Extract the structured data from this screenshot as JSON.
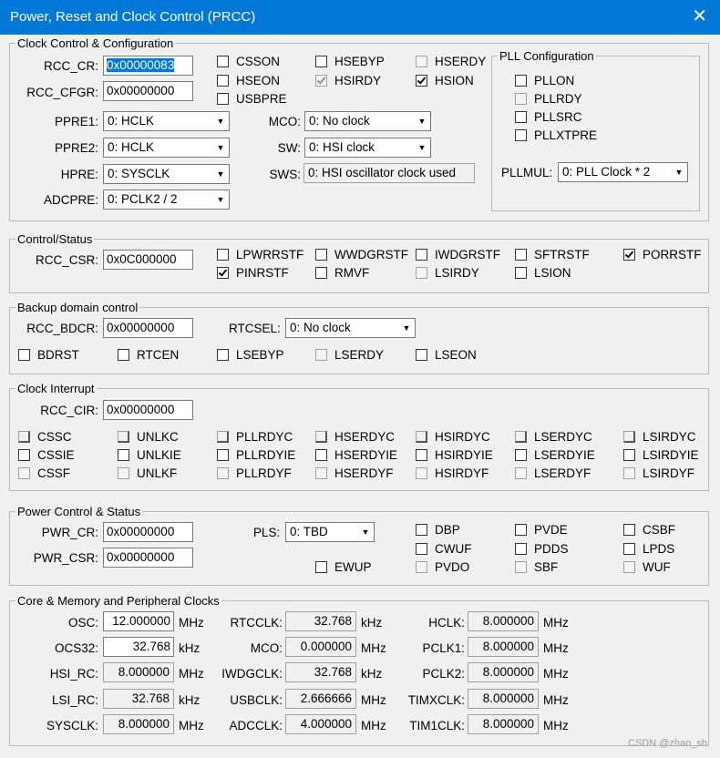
{
  "window": {
    "title": "Power, Reset and Clock Control (PRCC)",
    "close_glyph": "✕"
  },
  "clock_control": {
    "legend": "Clock Control & Configuration",
    "rcc_cr_label": "RCC_CR:",
    "rcc_cr_value": "0x00000083",
    "rcc_cfgr_label": "RCC_CFGR:",
    "rcc_cfgr_value": "0x00000000",
    "ppre1_label": "PPRE1:",
    "ppre1_value": "0: HCLK",
    "ppre2_label": "PPRE2:",
    "ppre2_value": "0: HCLK",
    "hpre_label": "HPRE:",
    "hpre_value": "0: SYSCLK",
    "adcpre_label": "ADCPRE:",
    "adcpre_value": "0: PCLK2 / 2",
    "mco_label": "MCO:",
    "mco_value": "0: No clock",
    "sw_label": "SW:",
    "sw_value": "0: HSI clock",
    "sws_label": "SWS:",
    "sws_value": "0: HSI oscillator clock used",
    "checks": {
      "csson": "CSSON",
      "hseon": "HSEON",
      "usbpre": "USBPRE",
      "hsebyp": "HSEBYP",
      "hsirdy": "HSIRDY",
      "hserdy": "HSERDY",
      "hsion": "HSION"
    }
  },
  "pll": {
    "legend": "PLL Configuration",
    "pllon": "PLLON",
    "pllrdy": "PLLRDY",
    "pllsrc": "PLLSRC",
    "pllxtpre": "PLLXTPRE",
    "pllmul_label": "PLLMUL:",
    "pllmul_value": "0: PLL Clock * 2"
  },
  "control_status": {
    "legend": "Control/Status",
    "rcc_csr_label": "RCC_CSR:",
    "rcc_csr_value": "0x0C000000",
    "lpwrrstf": "LPWRRSTF",
    "wwdgrstf": "WWDGRSTF",
    "iwdgrstf": "IWDGRSTF",
    "sftrstf": "SFTRSTF",
    "porrstf": "PORRSTF",
    "pinrstf": "PINRSTF",
    "rmvf": "RMVF",
    "lsirdy": "LSIRDY",
    "lsion": "LSION"
  },
  "backup": {
    "legend": "Backup domain control",
    "rcc_bdcr_label": "RCC_BDCR:",
    "rcc_bdcr_value": "0x00000000",
    "rtcsel_label": "RTCSEL:",
    "rtcsel_value": "0: No clock",
    "bdrst": "BDRST",
    "rtcen": "RTCEN",
    "lsebyp": "LSEBYP",
    "lserdy": "LSERDY",
    "lseon": "LSEON"
  },
  "clock_interrupt": {
    "legend": "Clock Interrupt",
    "rcc_cir_label": "RCC_CIR:",
    "rcc_cir_value": "0x00000000",
    "row1": [
      "CSSC",
      "UNLKC",
      "PLLRDYC",
      "HSERDYC",
      "HSIRDYC",
      "LSERDYC",
      "LSIRDYC"
    ],
    "row2": [
      "CSSIE",
      "UNLKIE",
      "PLLRDYIE",
      "HSERDYIE",
      "HSIRDYIE",
      "LSERDYIE",
      "LSIRDYIE"
    ],
    "row3": [
      "CSSF",
      "UNLKF",
      "PLLRDYF",
      "HSERDYF",
      "HSIRDYF",
      "LSERDYF",
      "LSIRDYF"
    ]
  },
  "power": {
    "legend": "Power Control & Status",
    "pwr_cr_label": "PWR_CR:",
    "pwr_cr_value": "0x00000000",
    "pwr_csr_label": "PWR_CSR:",
    "pwr_csr_value": "0x00000000",
    "pls_label": "PLS:",
    "pls_value": "0: TBD",
    "ewup": "EWUP",
    "dbp": "DBP",
    "cwuf": "CWUF",
    "pvdo": "PVDO",
    "pvde": "PVDE",
    "pdds": "PDDS",
    "sbf": "SBF",
    "csbf": "CSBF",
    "lpds": "LPDS",
    "wuf": "WUF"
  },
  "clocks": {
    "legend": "Core & Memory and Peripheral Clocks",
    "osc_label": "OSC:",
    "osc_value": "12.000000",
    "osc_unit": "MHz",
    "ocs32_label": "OCS32:",
    "ocs32_value": "32.768",
    "ocs32_unit": "kHz",
    "hsi_rc_label": "HSI_RC:",
    "hsi_rc_value": "8.000000",
    "hsi_rc_unit": "MHz",
    "lsi_rc_label": "LSI_RC:",
    "lsi_rc_value": "32.768",
    "lsi_rc_unit": "kHz",
    "sysclk_label": "SYSCLK:",
    "sysclk_value": "8.000000",
    "sysclk_unit": "MHz",
    "rtcclk_label": "RTCCLK:",
    "rtcclk_value": "32.768",
    "rtcclk_unit": "kHz",
    "mco_label": "MCO:",
    "mco_value": "0.000000",
    "mco_unit": "MHz",
    "iwdgclk_label": "IWDGCLK:",
    "iwdgclk_value": "32.768",
    "iwdgclk_unit": "kHz",
    "usbclk_label": "USBCLK:",
    "usbclk_value": "2.666666",
    "usbclk_unit": "MHz",
    "adcclk_label": "ADCCLK:",
    "adcclk_value": "4.000000",
    "adcclk_unit": "MHz",
    "hclk_label": "HCLK:",
    "hclk_value": "8.000000",
    "hclk_unit": "MHz",
    "pclk1_label": "PCLK1:",
    "pclk1_value": "8.000000",
    "pclk1_unit": "MHz",
    "pclk2_label": "PCLK2:",
    "pclk2_value": "8.000000",
    "pclk2_unit": "MHz",
    "timxclk_label": "TIMXCLK:",
    "timxclk_value": "8.000000",
    "timxclk_unit": "MHz",
    "tim1clk_label": "TIM1CLK:",
    "tim1clk_value": "8.000000",
    "tim1clk_unit": "MHz"
  },
  "watermark": "CSDN @zhao_sh"
}
